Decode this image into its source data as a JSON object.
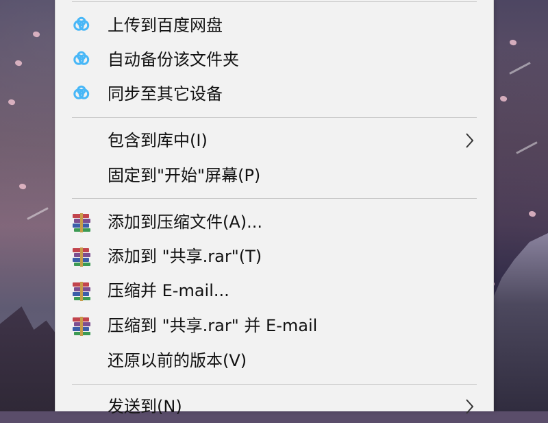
{
  "menu": {
    "groups": [
      {
        "items": [
          {
            "label": "上传到百度网盘",
            "icon": "baidu-netdisk-icon"
          },
          {
            "label": "自动备份该文件夹",
            "icon": "baidu-netdisk-icon"
          },
          {
            "label": "同步至其它设备",
            "icon": "baidu-netdisk-icon"
          }
        ]
      },
      {
        "items": [
          {
            "label": "包含到库中(I)",
            "has_submenu": true,
            "submenu_icon": "chevron-right-icon"
          },
          {
            "label": "固定到\"开始\"屏幕(P)"
          }
        ]
      },
      {
        "items": [
          {
            "label": "添加到压缩文件(A)...",
            "icon": "winrar-books-icon"
          },
          {
            "label": "添加到 \"共享.rar\"(T)",
            "icon": "winrar-books-icon"
          },
          {
            "label": "压缩并 E-mail...",
            "icon": "winrar-books-icon"
          },
          {
            "label": "压缩到 \"共享.rar\" 并 E-mail",
            "icon": "winrar-books-icon"
          },
          {
            "label": "还原以前的版本(V)"
          }
        ]
      },
      {
        "items": [
          {
            "label": "发送到(N)",
            "has_submenu": true,
            "submenu_icon": "chevron-right-icon"
          }
        ]
      }
    ]
  },
  "colors": {
    "menu_bg": "#f2f2f2",
    "separator": "#c8c8c8",
    "text": "#111111",
    "baidu_icon": "#48b7f7",
    "winrar_red": "#c2444c",
    "winrar_green": "#3c9a53",
    "winrar_blue": "#3b5ea9",
    "winrar_purple": "#7d4e8f",
    "winrar_strap": "#c79c49"
  }
}
